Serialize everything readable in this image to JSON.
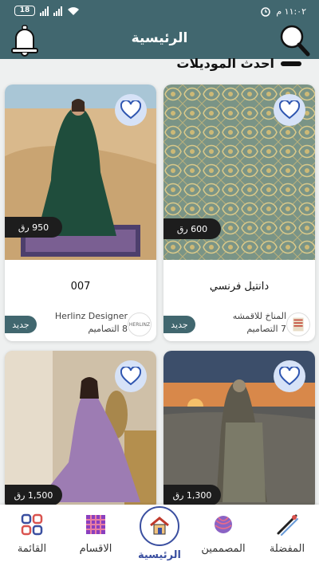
{
  "status": {
    "battery": "18",
    "time": "١١:٠٢ م"
  },
  "header": {
    "title": "الرئيسية"
  },
  "section": {
    "title": "احدث الموديلات"
  },
  "cards": [
    {
      "price": "600 رق",
      "name": "دانتيل فرنسي",
      "designer": "المناخ للاقمشه",
      "count": "7 التصاميم",
      "new": "جديد"
    },
    {
      "price": "950 رق",
      "name": "007",
      "designer": "Herlinz Designer",
      "count": "8 التصاميم",
      "new": "جديد",
      "logo": "HERLINZ"
    },
    {
      "price": "1,300 رق"
    },
    {
      "price": "1,500 رق"
    }
  ],
  "nav": [
    {
      "label": "المفضلة",
      "icon": "hairpin-icon"
    },
    {
      "label": "المصممين",
      "icon": "yarn-ball-icon"
    },
    {
      "label": "الرئيسية",
      "icon": "home-icon"
    },
    {
      "label": "الاقسام",
      "icon": "fabric-grid-icon"
    },
    {
      "label": "القائمة",
      "icon": "menu-grid-icon"
    }
  ]
}
